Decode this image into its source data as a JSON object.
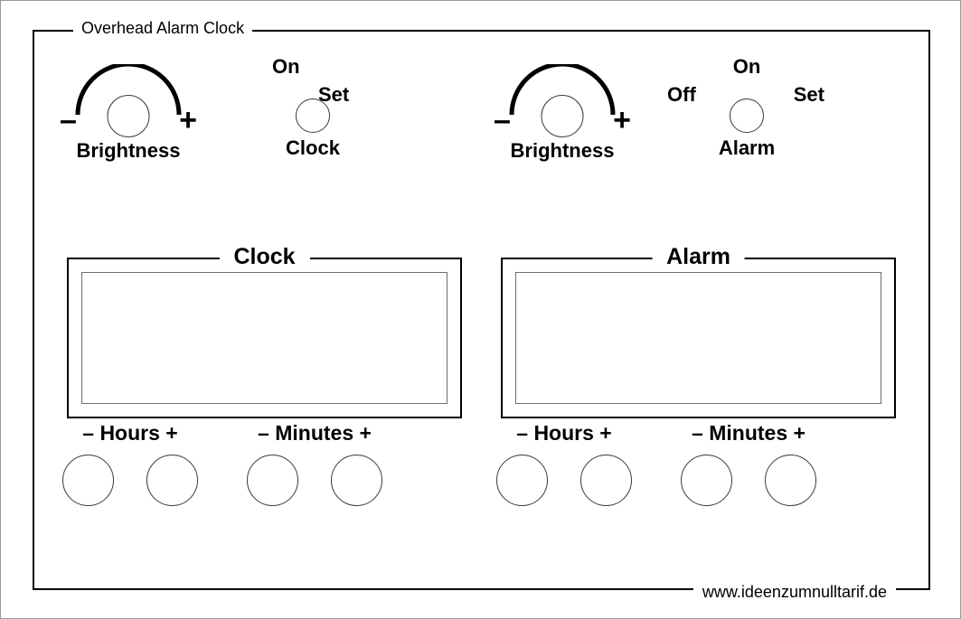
{
  "device": {
    "title": "Overhead Alarm Clock",
    "url": "www.ideenzumnulltarif.de"
  },
  "controls": {
    "clock_brightness": {
      "label": "Brightness",
      "minus": "–",
      "plus": "+"
    },
    "alarm_brightness": {
      "label": "Brightness",
      "minus": "–",
      "plus": "+"
    },
    "clock_switch": {
      "label": "Clock",
      "positions": [
        "On",
        "Set"
      ]
    },
    "alarm_switch": {
      "label": "Alarm",
      "positions": [
        "Off",
        "On",
        "Set"
      ]
    }
  },
  "displays": {
    "clock": {
      "legend": "Clock",
      "value": ""
    },
    "alarm": {
      "legend": "Alarm",
      "value": ""
    }
  },
  "buttons": {
    "clock_hours": {
      "caption": "–  Hours  +"
    },
    "clock_minutes": {
      "caption": "– Minutes +"
    },
    "alarm_hours": {
      "caption": "–  Hours  +"
    },
    "alarm_minutes": {
      "caption": "– Minutes +"
    }
  },
  "colors": {
    "line": "#000000",
    "thin_line": "#3a3a3a",
    "screen_line": "#6d6d6d",
    "background": "#ffffff",
    "image_border": "#9a9a9a"
  }
}
